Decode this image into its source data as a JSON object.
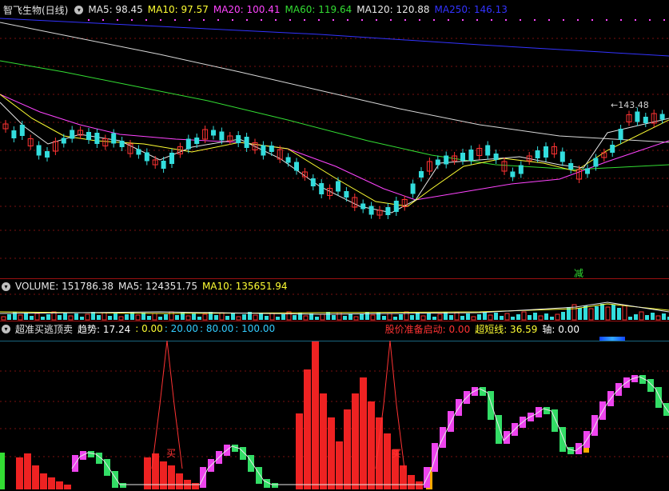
{
  "price": {
    "title": "智飞生物(日线)",
    "ma": [
      {
        "label": "MA5: 98.45",
        "color": "#e8e8e8"
      },
      {
        "label": "MA10: 97.57",
        "color": "#ffff33"
      },
      {
        "label": "MA20: 100.41",
        "color": "#ff44ff"
      },
      {
        "label": "MA60: 119.64",
        "color": "#33dd33"
      },
      {
        "label": "MA120: 120.88",
        "color": "#e8e8e8"
      },
      {
        "label": "MA250: 146.13",
        "color": "#3333ff"
      }
    ],
    "high_label": "143.48",
    "marker": "减"
  },
  "volume": {
    "title": "VOLUME: 151786.38",
    "ma5": "MA5: 124351.75",
    "ma10": "MA10: 135651.94"
  },
  "indicator": {
    "title": "超准买逃顶卖",
    "items": [
      {
        "label": "趋势: 17.24",
        "color": "#ffffff"
      },
      {
        "label": ": 0.00",
        "color": "#ffff33"
      },
      {
        "label": ": 20.00",
        "color": "#33ccff"
      },
      {
        "label": ": 80.00",
        "color": "#33ccff"
      },
      {
        "label": ": 100.00",
        "color": "#33ccff"
      }
    ],
    "right_items": [
      {
        "label": "股价准备启动: 0.00",
        "color": "#ff3333"
      },
      {
        "label": "超短线: 36.59",
        "color": "#ffff33"
      },
      {
        "label": "轴: 0.00",
        "color": "#ffffff"
      }
    ],
    "buy_label": "买"
  }
}
